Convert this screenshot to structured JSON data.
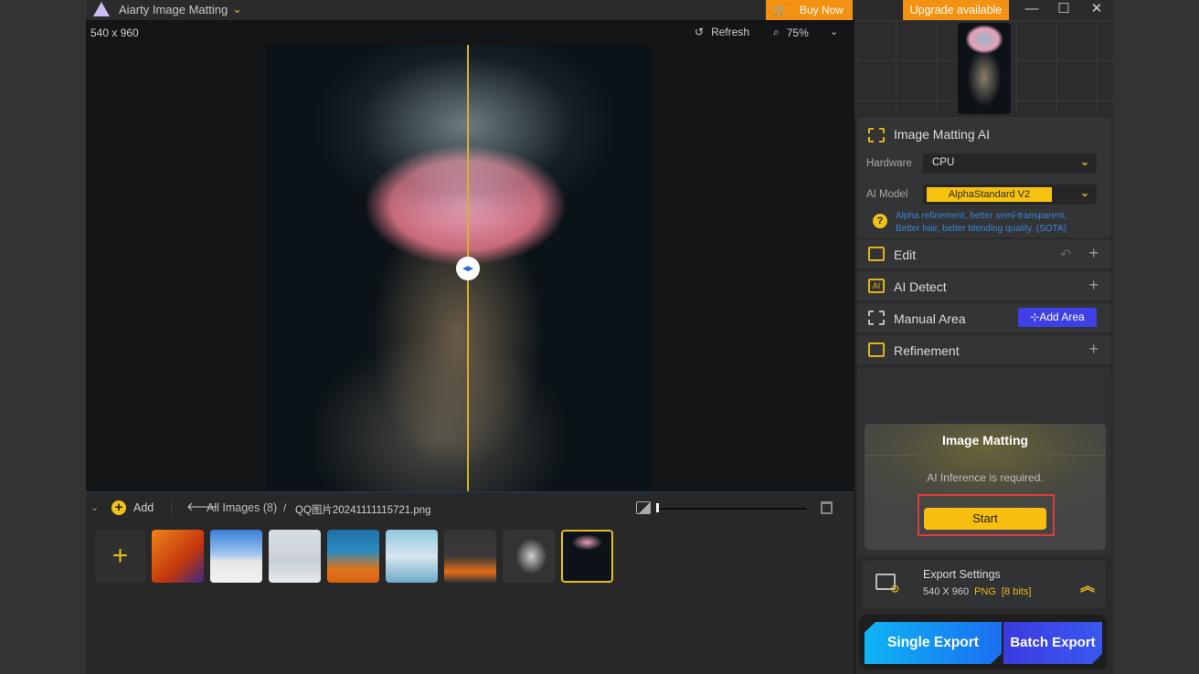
{
  "titlebar": {
    "app_title": "Aiarty Image Matting",
    "buy_now": "Buy Now",
    "upgrade": "Upgrade available",
    "minimize": "—",
    "maximize": "☐",
    "close": "✕"
  },
  "canvas": {
    "dimensions": "540 x 960",
    "refresh": "Refresh",
    "zoom": "75%",
    "split_handle": "◂▸"
  },
  "strip": {
    "add_label": "Add",
    "all_images": "All Images (8)",
    "slash": "/",
    "filename": "QQ图片20241111115721.png",
    "add_thumb": "+",
    "size_slider_value": 0,
    "thumbnails": [
      {
        "name": "orange-silhouette-woman",
        "bg": "linear-gradient(135deg,#f0821a,#c3360e 60%,#3a2a80)"
      },
      {
        "name": "skateboarder-jump",
        "bg": "linear-gradient(180deg,#3a7fd6 0%,#9cc4ef 45%,#e6e6e6 60%,#f2f2f2)"
      },
      {
        "name": "group-jumping-snow",
        "bg": "linear-gradient(180deg,#d9dfe4 0%,#c8cfd6 60%,#e8eaec)"
      },
      {
        "name": "blue-hair-orange-dress",
        "bg": "linear-gradient(180deg,#1f6fa5 0%,#2a8bc0 40%,#e0741a 75%,#d96010)"
      },
      {
        "name": "woman-blue-headscarf",
        "bg": "linear-gradient(180deg,#8fc7df 0%,#d6e6ee 50%,#6fa9c8)"
      },
      {
        "name": "woman-orange-dress-transparent",
        "bg": "linear-gradient(180deg,#333 0%,#3a3a3a 50%,#e26d17 80%,#333)"
      },
      {
        "name": "white-dancer-transparent",
        "bg": "radial-gradient(ellipse 40% 45% at 55% 50%,#cfcfcf,#333 75%)"
      },
      {
        "name": "jellyfish",
        "bg": "radial-gradient(ellipse 40% 20% at 50% 22%,#e9a0b8,#0c1217 80%)"
      }
    ]
  },
  "right_panel": {
    "matting_ai": {
      "title": "Image Matting AI",
      "hardware_label": "Hardware",
      "hardware_value": "CPU",
      "model_label": "AI Model",
      "model_value": "AlphaStandard  V2",
      "hint_icon": "?",
      "hint_line1": "Alpha refinement, better semi-transparent,",
      "hint_line2": "Better hair, better blending quality. (SOTA)"
    },
    "sections": {
      "edit": "Edit",
      "ai_detect": "AI Detect",
      "manual_area": "Manual Area",
      "add_area": "⊹Add Area",
      "refinement": "Refinement",
      "plus": "+",
      "undo": "↶"
    },
    "image_matting": {
      "title": "Image Matting",
      "message": "AI Inference is required.",
      "start": "Start"
    },
    "export": {
      "title": "Export Settings",
      "size": "540 X 960",
      "format": "PNG",
      "bits": "[8 bits]",
      "single": "Single Export",
      "batch": "Batch Export"
    }
  },
  "colors": {
    "accent_yellow": "#f6c20f",
    "accent_orange": "#f39212",
    "add_area_blue": "#3f3fe6",
    "hint_blue": "#3a86d8"
  }
}
